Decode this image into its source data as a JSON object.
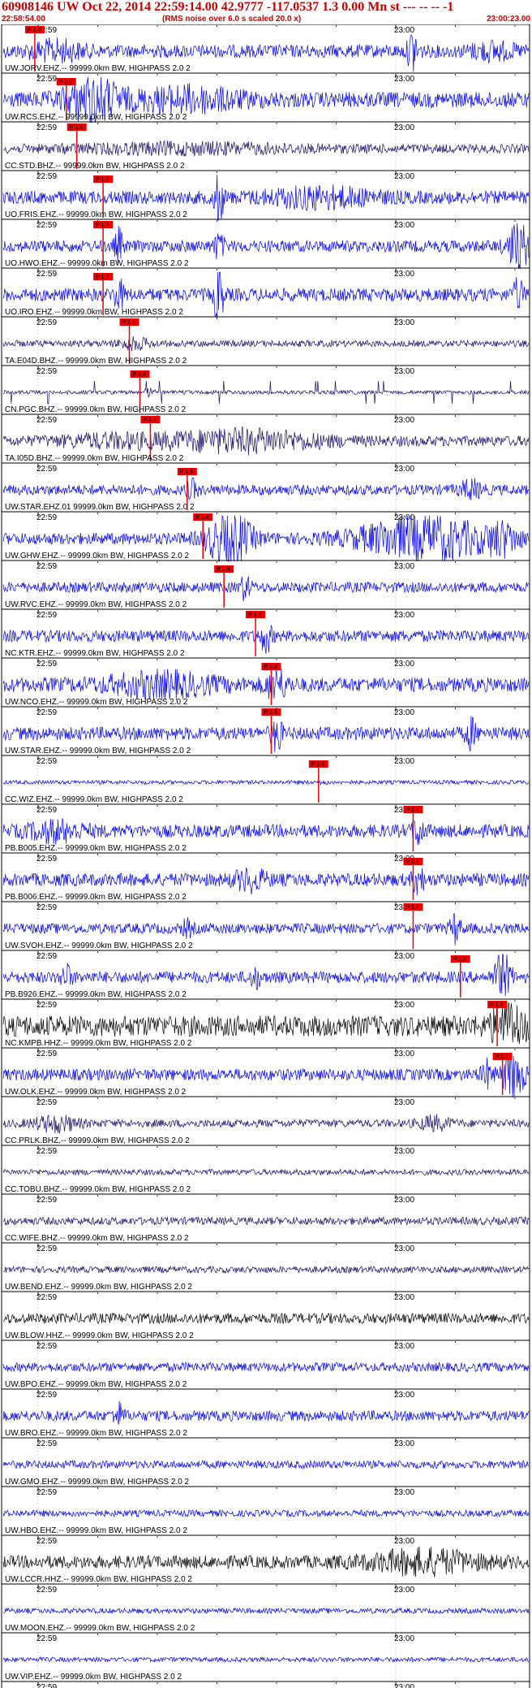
{
  "header": {
    "title": "60908146 UW Oct 22, 2014 22:59:14.00   42.9777 -117.0537  1.3 0.00 Mn st --- -- --  -1",
    "start_time": "22:58:54.00",
    "rms_note": "(RMS noise over 6.0 s scaled 20.0 x)",
    "end_time": "23:00:23.00"
  },
  "colors": {
    "blue": "#0000ee",
    "navy": "#1a0a66",
    "black": "#000000",
    "pick": "#ee0000"
  },
  "ticks": [
    "22:59",
    "23:00"
  ],
  "pick_text": "P 1.4",
  "traces": [
    {
      "label": "UW.JORV.EHZ.-- 99999.0km BW, HIGHPASS  2.0  2",
      "color": "blue",
      "amp": 0.5,
      "pick": 0.06,
      "bursts": [
        [
          0.93,
          1.0,
          0.04
        ],
        [
          0.78,
          3.0,
          0.01
        ],
        [
          0.1,
          1.2,
          0.05
        ]
      ]
    },
    {
      "label": "UW.RCS.EHZ.-- 99999.0km BW, HIGHPASS  2.0  2",
      "color": "blue",
      "amp": 0.6,
      "pick": 0.12,
      "bursts": [
        [
          0.17,
          2.5,
          0.05
        ],
        [
          0.35,
          1.2,
          0.1
        ]
      ]
    },
    {
      "label": "CC.STD.BHZ.-- 99999.0km BW, HIGHPASS  2.0  2",
      "color": "navy",
      "amp": 0.35,
      "pick": 0.14,
      "bursts": [
        [
          0.35,
          0.8,
          0.2
        ]
      ]
    },
    {
      "label": "UO.FRIS.EHZ.-- 99999.0km BW, HIGHPASS  2.0  2",
      "color": "blue",
      "amp": 0.5,
      "pick": 0.19,
      "bursts": [
        [
          0.41,
          4.5,
          0.008
        ],
        [
          0.6,
          1.2,
          0.1
        ]
      ]
    },
    {
      "label": "UO.HWO.EHZ.-- 99999.0km BW, HIGHPASS  2.0  2",
      "color": "blue",
      "amp": 0.45,
      "pick": 0.19,
      "bursts": [
        [
          0.22,
          2.5,
          0.008
        ],
        [
          0.41,
          1.8,
          0.01
        ],
        [
          0.98,
          4.0,
          0.02
        ]
      ]
    },
    {
      "label": "UO.IRO.EHZ.-- 99999.0km BW, HIGHPASS  2.0  2",
      "color": "blue",
      "amp": 0.5,
      "pick": 0.19,
      "bursts": [
        [
          0.41,
          5.0,
          0.008
        ],
        [
          0.22,
          2.0,
          0.01
        ],
        [
          0.98,
          2.0,
          0.01
        ]
      ]
    },
    {
      "label": "TA.E04D.BHZ.-- 99999.0km BW, HIGHPASS  2.0  2",
      "color": "navy",
      "amp": 0.25,
      "pick": 0.24,
      "bursts": [
        [
          0.25,
          1.5,
          0.03
        ]
      ]
    },
    {
      "label": "CN.PGC.BHZ.-- 99999.0km BW, HIGHPASS  2.0  2",
      "color": "navy",
      "amp": 0.15,
      "pick": 0.26,
      "spiky": true,
      "bursts": [
        [
          0.28,
          2.0,
          0.01
        ]
      ]
    },
    {
      "label": "TA.I05D.BHZ.-- 99999.0km BW, HIGHPASS  2.0  2",
      "color": "navy",
      "amp": 0.4,
      "pick": 0.28,
      "bursts": [
        [
          0.45,
          1.8,
          0.15
        ],
        [
          0.2,
          0.8,
          0.1
        ]
      ]
    },
    {
      "label": "UW.STAR.EHZ.01 99999.0km BW, HIGHPASS  2.0  2",
      "color": "blue",
      "amp": 0.4,
      "pick": 0.35,
      "bursts": [
        [
          0.89,
          1.5,
          0.02
        ],
        [
          0.36,
          1.5,
          0.01
        ]
      ]
    },
    {
      "label": "UW.GHW.EHZ.-- 99999.0km BW, HIGHPASS  2.0  2",
      "color": "blue",
      "amp": 0.45,
      "pick": 0.38,
      "bursts": [
        [
          0.43,
          4.5,
          0.04
        ],
        [
          0.8,
          3.5,
          0.12
        ],
        [
          0.95,
          2.0,
          0.03
        ]
      ]
    },
    {
      "label": "UW.RVC.EHZ.-- 99999.0km BW, HIGHPASS  2.0  2",
      "color": "blue",
      "amp": 0.4,
      "pick": 0.42,
      "bursts": [
        [
          0.46,
          2.0,
          0.01
        ]
      ]
    },
    {
      "label": "NC.KTR.EHZ.-- 99999.0km BW, HIGHPASS  2.0  2",
      "color": "blue",
      "amp": 0.45,
      "pick": 0.48,
      "bursts": [
        [
          0.5,
          2.5,
          0.01
        ]
      ]
    },
    {
      "label": "UW.NCO.EHZ.-- 99999.0km BW, HIGHPASS  2.0  2",
      "color": "blue",
      "amp": 0.55,
      "pick": 0.51,
      "bursts": [
        [
          0.52,
          1.8,
          0.02
        ],
        [
          0.3,
          1.3,
          0.1
        ]
      ]
    },
    {
      "label": "UW.STAR.EHZ.-- 99999.0km BW, HIGHPASS  2.0  2",
      "color": "blue",
      "amp": 0.5,
      "pick": 0.51,
      "bursts": [
        [
          0.52,
          2.5,
          0.01
        ],
        [
          0.89,
          2.0,
          0.01
        ]
      ]
    },
    {
      "label": "CC.WIZ.EHZ.-- 99999.0km BW, HIGHPASS  2.0  2",
      "color": "blue",
      "amp": 0.15,
      "pick": 0.6,
      "bursts": [
        [
          0.61,
          1.0,
          0.005
        ]
      ]
    },
    {
      "label": "PB.B005.EHZ.-- 99999.0km BW, HIGHPASS  2.0  2",
      "color": "blue",
      "amp": 0.5,
      "pick": 0.78,
      "bursts": [
        [
          0.79,
          2.0,
          0.01
        ],
        [
          0.1,
          1.2,
          0.05
        ]
      ]
    },
    {
      "label": "PB.B006.EHZ.-- 99999.0km BW, HIGHPASS  2.0  2",
      "color": "blue",
      "amp": 0.5,
      "pick": 0.78,
      "bursts": [
        [
          0.79,
          2.0,
          0.01
        ],
        [
          0.47,
          1.3,
          0.03
        ]
      ]
    },
    {
      "label": "UW.SVOH.EHZ.-- 99999.0km BW, HIGHPASS  2.0  2",
      "color": "blue",
      "amp": 0.4,
      "pick": 0.78,
      "bursts": [
        [
          0.86,
          2.5,
          0.01
        ],
        [
          0.35,
          1.3,
          0.01
        ]
      ]
    },
    {
      "label": "PB.B926.EHZ.-- 99999.0km BW, HIGHPASS  2.0  2",
      "color": "blue",
      "amp": 0.45,
      "pick": 0.87,
      "bursts": [
        [
          0.95,
          4.0,
          0.015
        ],
        [
          0.48,
          1.5,
          0.01
        ],
        [
          0.12,
          1.8,
          0.01
        ]
      ]
    },
    {
      "label": "NC.KMPB.HHZ.-- 99999.0km BW, HIGHPASS  2.0  2",
      "color": "black",
      "amp": 0.8,
      "pick": 0.94,
      "bursts": [
        [
          0.96,
          2.0,
          0.03
        ]
      ]
    },
    {
      "label": "UW.OLK.EHZ.-- 99999.0km BW, HIGHPASS  2.0  2",
      "color": "blue",
      "amp": 0.45,
      "pick": 0.95,
      "bursts": [
        [
          0.97,
          4.0,
          0.02
        ],
        [
          0.92,
          2.0,
          0.01
        ]
      ]
    },
    {
      "label": "CC.PRLK.BHZ.-- 99999.0km BW, HIGHPASS  2.0  2",
      "color": "navy",
      "amp": 0.3,
      "bursts": [
        [
          0.1,
          1.8,
          0.04
        ],
        [
          0.82,
          1.5,
          0.03
        ]
      ]
    },
    {
      "label": "CC.TOBU.BHZ.-- 99999.0km BW, HIGHPASS  2.0  2",
      "color": "navy",
      "amp": 0.22,
      "bursts": []
    },
    {
      "label": "CC.WIFE.BHZ.-- 99999.0km BW, HIGHPASS  2.0  2",
      "color": "navy",
      "amp": 0.3,
      "bursts": []
    },
    {
      "label": "UW.BEND.EHZ.-- 99999.0km BW, HIGHPASS  2.0  2",
      "color": "navy",
      "amp": 0.25,
      "bursts": []
    },
    {
      "label": "UW.BLOW.HHZ.-- 99999.0km BW, HIGHPASS  2.0  2",
      "color": "black",
      "amp": 0.4,
      "bursts": []
    },
    {
      "label": "UW.BPO.EHZ.-- 99999.0km BW, HIGHPASS  2.0  2",
      "color": "blue",
      "amp": 0.35,
      "bursts": []
    },
    {
      "label": "UW.BRO.EHZ.-- 99999.0km BW, HIGHPASS  2.0  2",
      "color": "blue",
      "amp": 0.4,
      "bursts": [
        [
          0.22,
          2.0,
          0.01
        ]
      ]
    },
    {
      "label": "UW.GMO.EHZ.-- 99999.0km BW, HIGHPASS  2.0  2",
      "color": "blue",
      "amp": 0.3,
      "bursts": []
    },
    {
      "label": "UW.HBO.EHZ.-- 99999.0km BW, HIGHPASS  2.0  2",
      "color": "blue",
      "amp": 0.25,
      "bursts": []
    },
    {
      "label": "UW.LCCR.HHZ.-- 99999.0km BW, HIGHPASS  2.0  2",
      "color": "black",
      "amp": 0.5,
      "bursts": [
        [
          0.8,
          1.5,
          0.1
        ]
      ]
    },
    {
      "label": "UW.MOON.EHZ.-- 99999.0km BW, HIGHPASS  2.0  2",
      "color": "blue",
      "amp": 0.2,
      "bursts": []
    },
    {
      "label": "UW.VIP.EHZ.-- 99999.0km BW, HIGHPASS  2.0  2",
      "color": "blue",
      "amp": 0.18,
      "bursts": []
    },
    {
      "label": "",
      "color": "blue",
      "amp": 0.15,
      "bursts": []
    }
  ]
}
